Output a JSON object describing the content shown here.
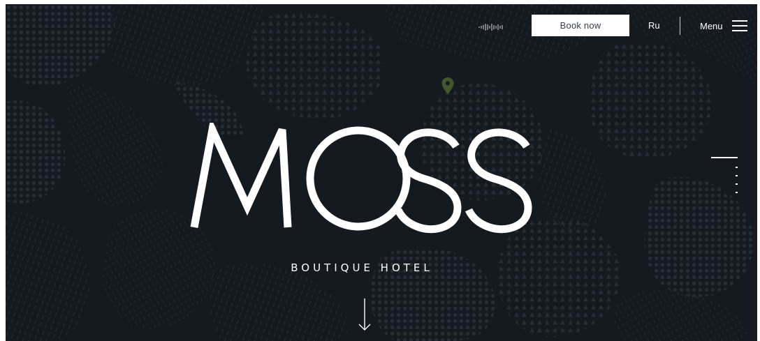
{
  "header": {
    "sound_icon": "sound-wave-icon",
    "book_label": "Book now",
    "lang_label": "Ru",
    "menu_label": "Menu",
    "menu_icon": "hamburger-icon"
  },
  "hero": {
    "pin_icon": "location-pin-icon",
    "logo_text": "MOSS",
    "subtitle": "BOUTIQUE HOTEL",
    "scroll_icon": "arrow-down-icon"
  },
  "pager": {
    "slides": 5,
    "active_index": 0
  },
  "colors": {
    "background": "#151a21",
    "texture": "#2a313b",
    "accent_pin": "#3e5a2c",
    "text": "#ffffff"
  }
}
